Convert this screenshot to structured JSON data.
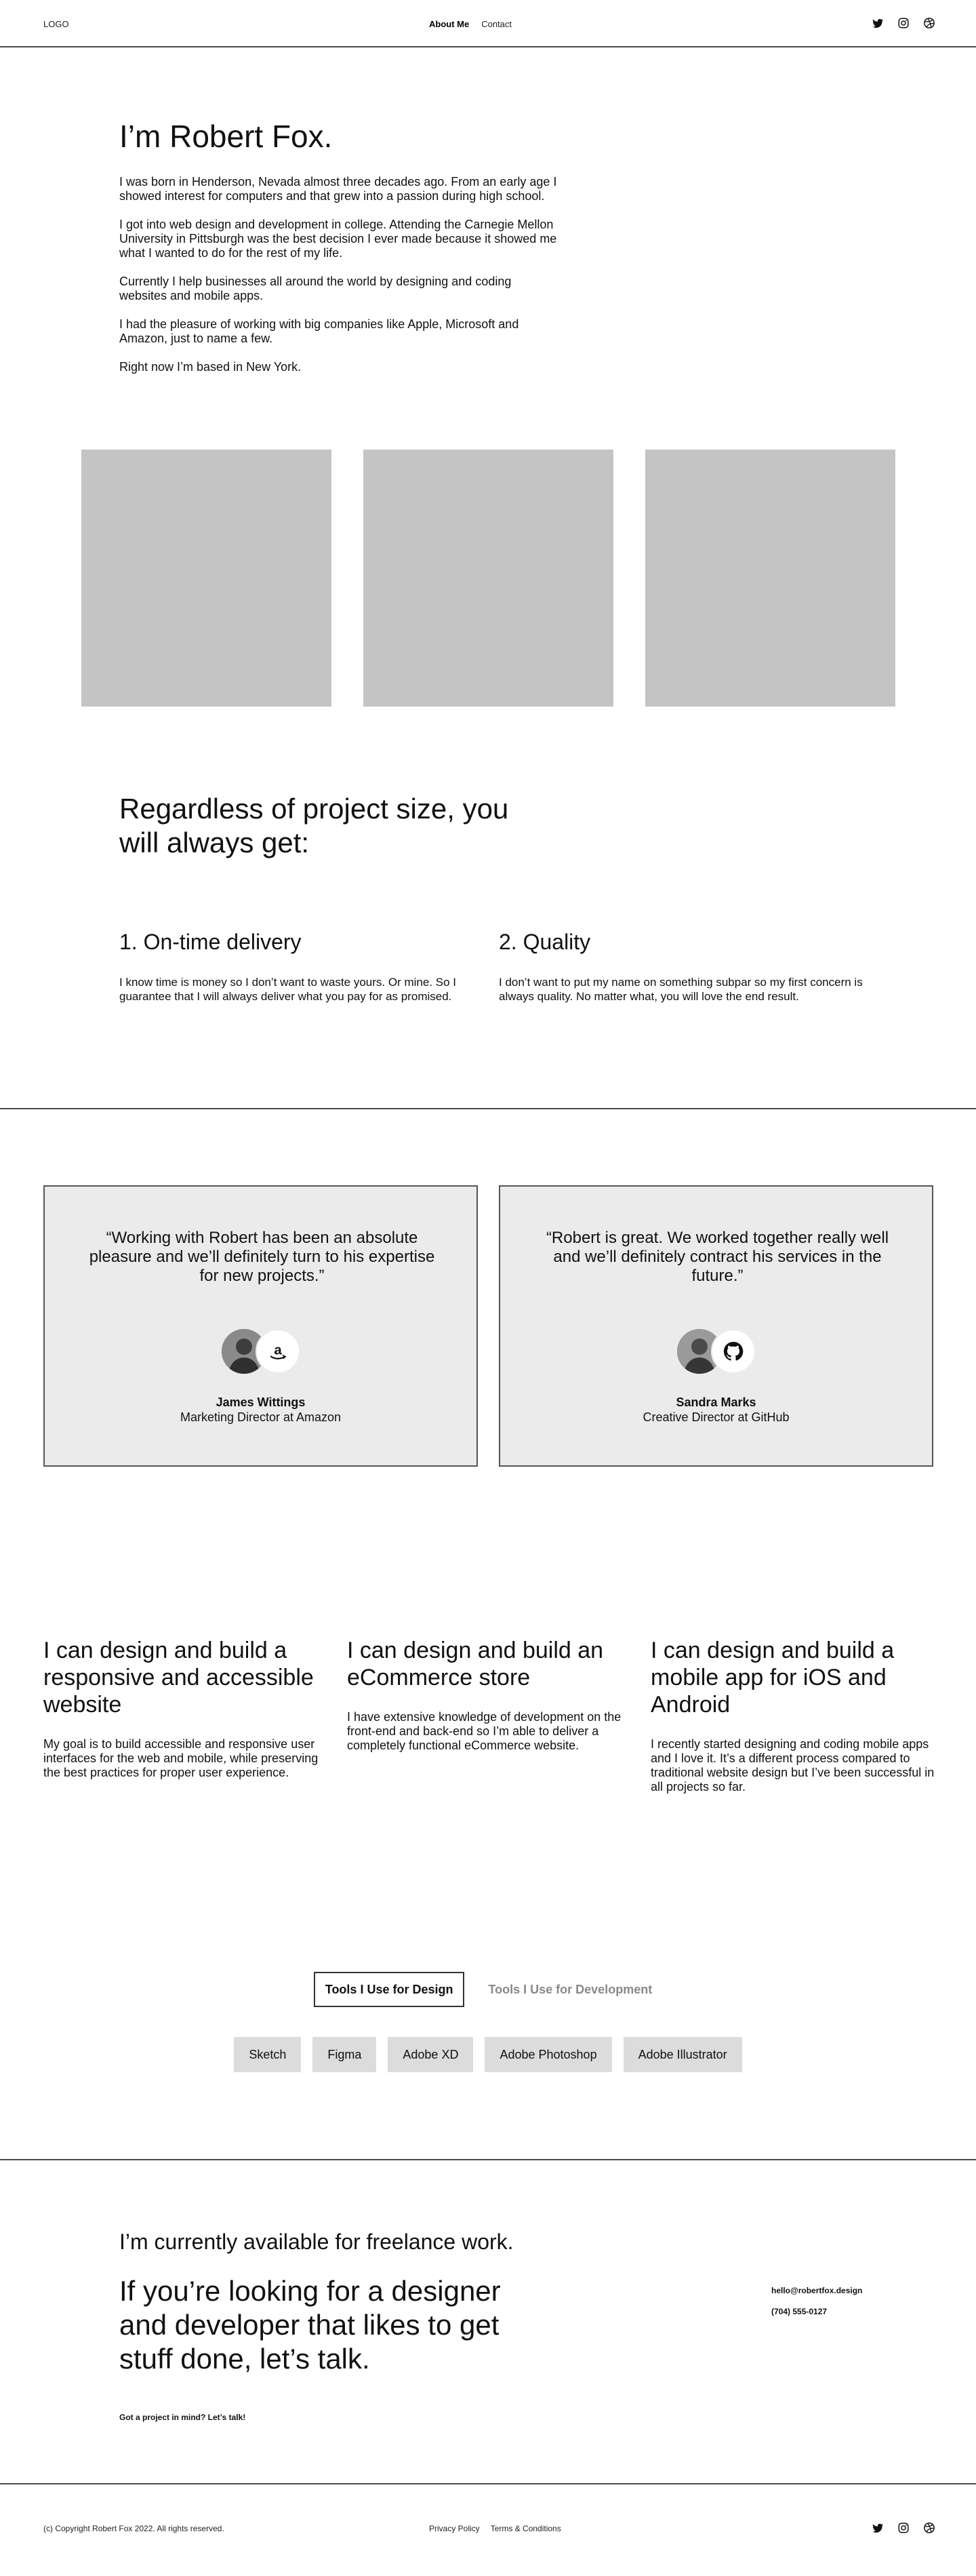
{
  "header": {
    "logo": "LOGO",
    "nav": {
      "about": "About Me",
      "contact": "Contact"
    },
    "social_icons": [
      "twitter-icon",
      "instagram-icon",
      "dribbble-icon"
    ]
  },
  "intro": {
    "title": "I’m Robert Fox.",
    "paragraphs": [
      "I was born in Henderson, Nevada almost three decades ago. From an early age I showed interest for computers and that grew into a passion during high school.",
      "I got into web design and development in college. Attending the Carnegie Mellon University in Pittsburgh was the best decision I ever made because it showed me what I wanted to do for the rest of my life.",
      "Currently I help businesses all around the world by designing and coding websites and mobile apps.",
      "I had the pleasure of working with big companies like Apple, Microsoft and Amazon, just to name a few.",
      "Right now I’m based in New York."
    ]
  },
  "promise": {
    "title": "Regardless of project size, you will always get:",
    "features": [
      {
        "title": "1. On-time delivery",
        "text": "I know time is money so I don’t want to waste yours. Or mine. So I guarantee that I will always deliver what you pay for as promised."
      },
      {
        "title": "2. Quality",
        "text": "I don’t want to put my name on something subpar so my first concern is always quality. No matter what, you will love the end result."
      }
    ]
  },
  "testimonials": [
    {
      "quote": "“Working with Robert has been an absolute pleasure and we’ll definitely turn to his expertise for new projects.”",
      "name": "James Wittings",
      "role": "Marketing Director at Amazon",
      "company_icon": "amazon-logo-icon"
    },
    {
      "quote": "“Robert is great. We worked together really well and we’ll definitely contract his services in the future.”",
      "name": "Sandra Marks",
      "role": "Creative Director at GitHub",
      "company_icon": "github-logo-icon"
    }
  ],
  "services": [
    {
      "title": "I can design and build a responsive and accessible website",
      "text": "My goal is to build accessible and responsive user interfaces for the web and mobile, while preserving the best practices for proper user experience."
    },
    {
      "title": "I can design and build an eCommerce store",
      "text": "I have extensive knowledge of development on the front-end and back-end so I’m able to deliver a completely functional eCommerce website."
    },
    {
      "title": "I can design and build a mobile app for iOS and Android",
      "text": "I recently started designing and coding mobile apps and I love it. It’s a different process compared to traditional website design but I’ve been successful in all projects so far."
    }
  ],
  "tools": {
    "tabs": [
      "Tools I Use for Design",
      "Tools I Use for Development"
    ],
    "active_tab": "Tools I Use for Design",
    "items": [
      "Sketch",
      "Figma",
      "Adobe XD",
      "Adobe Photoshop",
      "Adobe Illustrator"
    ]
  },
  "contact": {
    "freelance": "I’m currently available for freelance work.",
    "talk": "If you’re looking for a designer and developer that likes to get stuff done, let’s talk.",
    "cta": "Got a project in mind? Let’s talk!",
    "email": "hello@robertfox.design",
    "phone": "(704) 555-0127"
  },
  "footer": {
    "copyright": "(c) Copyright Robert Fox 2022. All rights reserved.",
    "links": [
      "Privacy Policy",
      "Terms & Conditions"
    ]
  },
  "colors": {
    "divider": "#4a4a4a",
    "image_placeholder": "#c4c4c4",
    "card_background": "#ebebeb",
    "chip_background": "#dcdcdc",
    "inactive_tab_text": "#888888"
  }
}
